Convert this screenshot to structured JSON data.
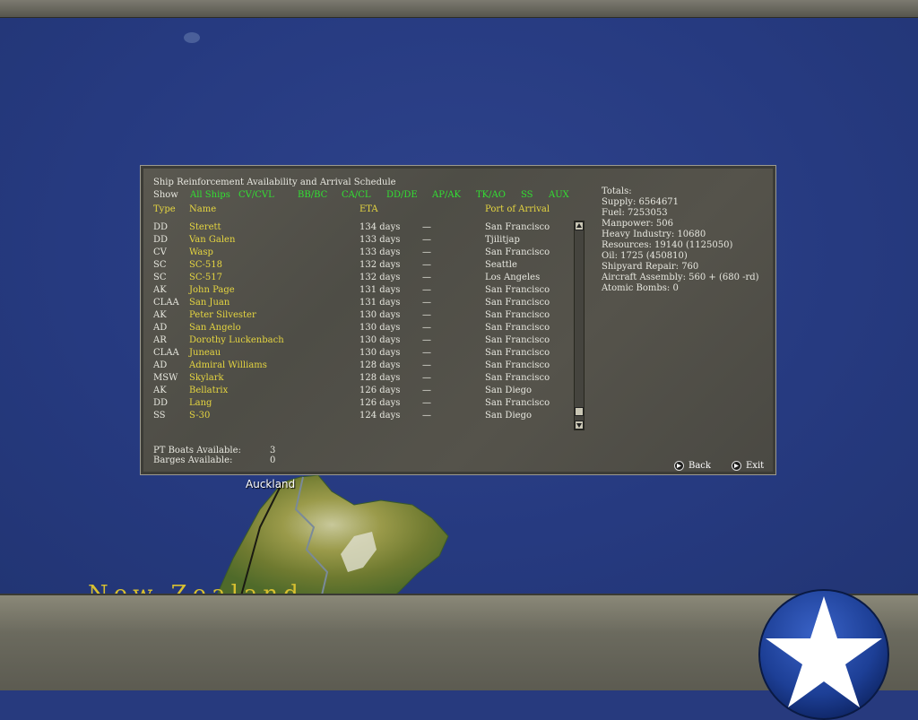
{
  "panel": {
    "title": "Ship Reinforcement Availability and Arrival Schedule",
    "show_label": "Show",
    "filters": [
      "All Ships",
      "CV/CVL",
      "BB/BC",
      "CA/CL",
      "DD/DE",
      "AP/AK",
      "TK/AO",
      "SS",
      "AUX"
    ],
    "headers": {
      "type": "Type",
      "name": "Name",
      "eta": "ETA",
      "port": "Port of Arrival"
    },
    "ships": [
      {
        "type": "DD",
        "name": "Sterett",
        "eta": "134 days",
        "sep": "—",
        "port": "San Francisco"
      },
      {
        "type": "DD",
        "name": "Van Galen",
        "eta": "133 days",
        "sep": "—",
        "port": "Tjilitjap"
      },
      {
        "type": "CV",
        "name": "Wasp",
        "eta": "133 days",
        "sep": "—",
        "port": "San Francisco"
      },
      {
        "type": "SC",
        "name": "SC-518",
        "eta": "132 days",
        "sep": "—",
        "port": "Seattle"
      },
      {
        "type": "SC",
        "name": "SC-517",
        "eta": "132 days",
        "sep": "—",
        "port": "Los Angeles"
      },
      {
        "type": "AK",
        "name": "John Page",
        "eta": "131 days",
        "sep": "—",
        "port": "San Francisco"
      },
      {
        "type": "CLAA",
        "name": "San Juan",
        "eta": "131 days",
        "sep": "—",
        "port": "San Francisco"
      },
      {
        "type": "AK",
        "name": "Peter Silvester",
        "eta": "130 days",
        "sep": "—",
        "port": "San Francisco"
      },
      {
        "type": "AD",
        "name": "San Angelo",
        "eta": "130 days",
        "sep": "—",
        "port": "San Francisco"
      },
      {
        "type": "AR",
        "name": "Dorothy Luckenbach",
        "eta": "130 days",
        "sep": "—",
        "port": "San Francisco"
      },
      {
        "type": "CLAA",
        "name": "Juneau",
        "eta": "130 days",
        "sep": "—",
        "port": "San Francisco"
      },
      {
        "type": "AD",
        "name": "Admiral Williams",
        "eta": "128 days",
        "sep": "—",
        "port": "San Francisco"
      },
      {
        "type": "MSW",
        "name": "Skylark",
        "eta": "128 days",
        "sep": "—",
        "port": "San Francisco"
      },
      {
        "type": "AK",
        "name": "Bellatrix",
        "eta": "126 days",
        "sep": "—",
        "port": "San Diego"
      },
      {
        "type": "DD",
        "name": "Lang",
        "eta": "126 days",
        "sep": "—",
        "port": "San Francisco"
      },
      {
        "type": "SS",
        "name": "S-30",
        "eta": "124 days",
        "sep": "—",
        "port": "San Diego"
      }
    ],
    "pt_label": "PT Boats Available:",
    "pt_value": "3",
    "barges_label": "Barges Available:",
    "barges_value": "0",
    "totals": [
      "Totals:",
      "Supply: 6564671",
      "Fuel: 7253053",
      "Manpower: 506",
      "Heavy Industry: 10680",
      "Resources: 19140 (1125050)",
      "Oil: 1725 (450810)",
      "Shipyard Repair: 760",
      "Aircraft Assembly: 560 + (680 -rd)",
      "Atomic Bombs: 0"
    ],
    "back_label": "Back",
    "exit_label": "Exit"
  },
  "map": {
    "city_label": "Auckland",
    "region_label": "New Zealand"
  },
  "colors": {
    "ocean": "#273a7e",
    "text_white": "#e8e8e0",
    "text_yellow": "#e6d640",
    "filter_green": "#32e032",
    "panel_bg": "#55534b"
  },
  "icons": {
    "emblem": "us-star-roundel-icon",
    "scroll_up": "arrow-up-icon",
    "scroll_down": "arrow-down-icon",
    "nav": "arrow-right-icon"
  }
}
